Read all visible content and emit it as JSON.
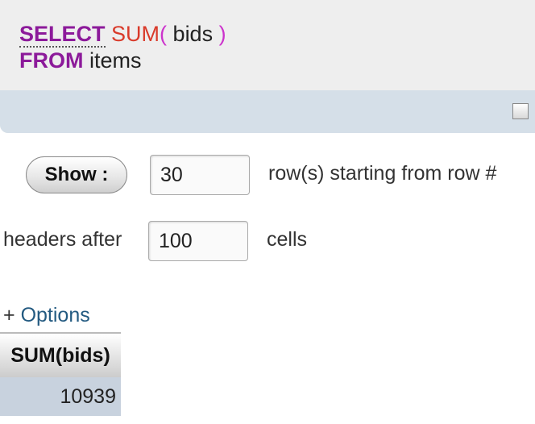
{
  "sql": {
    "select_kw": "SELECT",
    "func": "SUM",
    "open_paren": "(",
    "column": "bids",
    "close_paren": ")",
    "from_kw": "FROM",
    "table": "items"
  },
  "controls": {
    "show_button": "Show :",
    "rows_value": "30",
    "rows_label": "row(s) starting from row #",
    "headers_label": "headers after",
    "cells_value": "100",
    "cells_label": "cells"
  },
  "options": {
    "plus": "+",
    "label": "Options"
  },
  "results": {
    "header": "SUM(bids)",
    "value": "10939"
  }
}
